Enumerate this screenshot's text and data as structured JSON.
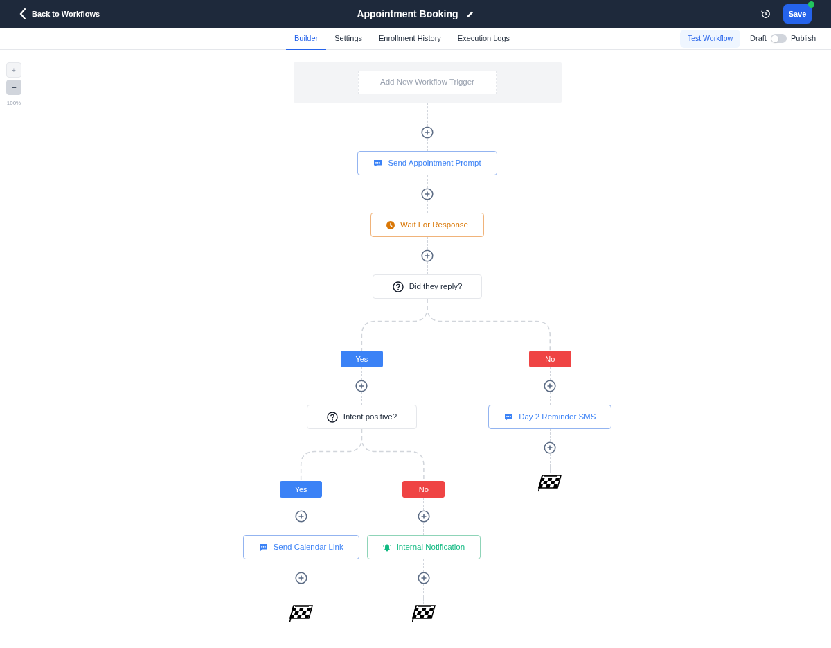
{
  "header": {
    "back_link": "Back to Workflows",
    "title": "Appointment Booking",
    "save_button": "Save",
    "unsaved": true
  },
  "tabs": [
    {
      "label": "Builder",
      "selected": true
    },
    {
      "label": "Settings",
      "selected": false
    },
    {
      "label": "Enrollment History",
      "selected": false
    },
    {
      "label": "Execution Logs",
      "selected": false
    }
  ],
  "test_button": "Test Workflow",
  "publish_toggle": {
    "off_label": "Draft",
    "on_label": "Publish",
    "on": false
  },
  "zoom_controls": {
    "zoom_in": "+",
    "zoom_out": "−",
    "reading": "100%"
  },
  "trigger": {
    "placeholder": "Add New Workflow Trigger"
  },
  "steps": [
    {
      "kind": "message",
      "label": "Send Appointment Prompt"
    },
    {
      "kind": "wait",
      "label": "Wait For Response"
    },
    {
      "kind": "condition",
      "label": "Did they reply?",
      "branches": [
        {
          "kind": "yes",
          "label": "Yes",
          "steps": [
            {
              "kind": "condition",
              "label": "Intent positive?",
              "branches": [
                {
                  "kind": "yes",
                  "label": "Yes",
                  "steps": [
                    {
                      "kind": "message",
                      "label": "Send Calendar Link"
                    },
                    {
                      "kind": "end"
                    }
                  ]
                },
                {
                  "kind": "no",
                  "label": "No",
                  "steps": [
                    {
                      "kind": "notification",
                      "label": "Internal Notification"
                    },
                    {
                      "kind": "end"
                    }
                  ]
                }
              ]
            }
          ]
        },
        {
          "kind": "no",
          "label": "No",
          "steps": [
            {
              "kind": "message",
              "label": "Day 2 Reminder SMS"
            },
            {
              "kind": "end"
            }
          ]
        }
      ]
    }
  ]
}
